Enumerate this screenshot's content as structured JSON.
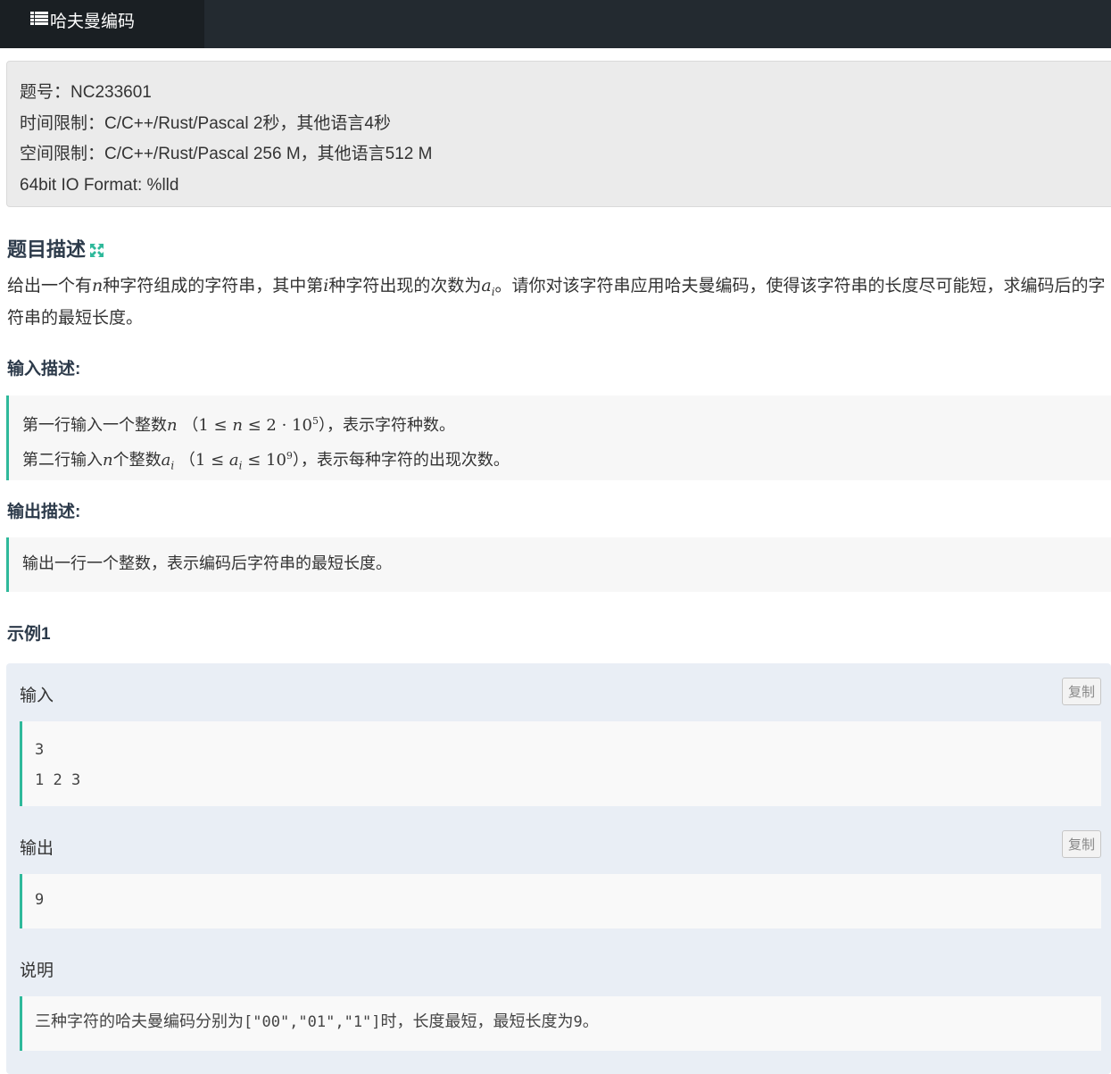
{
  "header": {
    "tab_title": "哈夫曼编码"
  },
  "info": {
    "problem_id": "题号：NC233601",
    "time_limit": "时间限制：C/C++/Rust/Pascal 2秒，其他语言4秒",
    "memory_limit": "空间限制：C/C++/Rust/Pascal 256 M，其他语言512 M",
    "io_format": "64bit IO Format: %lld"
  },
  "description": {
    "title": "题目描述",
    "p1": "给出一个有",
    "var_n": "n",
    "p2": "种字符组成的字符串，其中第",
    "var_i": "i",
    "p3": "种字符出现的次数为",
    "var_a": "a",
    "sub_i": "i",
    "p4": "。请你对该字符串应用哈夫曼编码，使得该字符串的长度尽可能短，求编码后的字符串的最短长度。"
  },
  "input_desc": {
    "title": "输入描述:",
    "l1_a": "第一行输入一个整数",
    "l1_n": "n",
    "l1_paren_open": "（",
    "l1_math_a": "1 ≤ ",
    "l1_math_n": "n",
    "l1_math_b": " ≤ 2 · 10",
    "l1_exp": "5",
    "l1_b": "），表示字符种数。",
    "l2_a": "第二行输入",
    "l2_n": "n",
    "l2_b": "个整数",
    "l2_a_var": "a",
    "l2_sub": "i",
    "l2_paren_open": "（",
    "l2_math_a": "1 ≤ ",
    "l2_math_var": "a",
    "l2_math_sub": "i",
    "l2_math_b": " ≤ 10",
    "l2_exp": "9",
    "l2_c": "），表示每种字符的出现次数。"
  },
  "output_desc": {
    "title": "输出描述:",
    "line": "输出一行一个整数，表示编码后字符串的最短长度。"
  },
  "example": {
    "title": "示例1",
    "input_label": "输入",
    "output_label": "输出",
    "explain_label": "说明",
    "copy_label": "复制",
    "input_lines": [
      "3",
      "1 2 3"
    ],
    "output_lines": [
      "9"
    ],
    "explain_a": "三种字符的哈夫曼编码分别为",
    "explain_code": "[\"00\",\"01\",\"1\"]",
    "explain_b": "时，长度最短，最短长度为",
    "explain_num": "9",
    "explain_c": "。"
  },
  "colors": {
    "accent": "#2fb99b",
    "topbar": "#232a30"
  }
}
